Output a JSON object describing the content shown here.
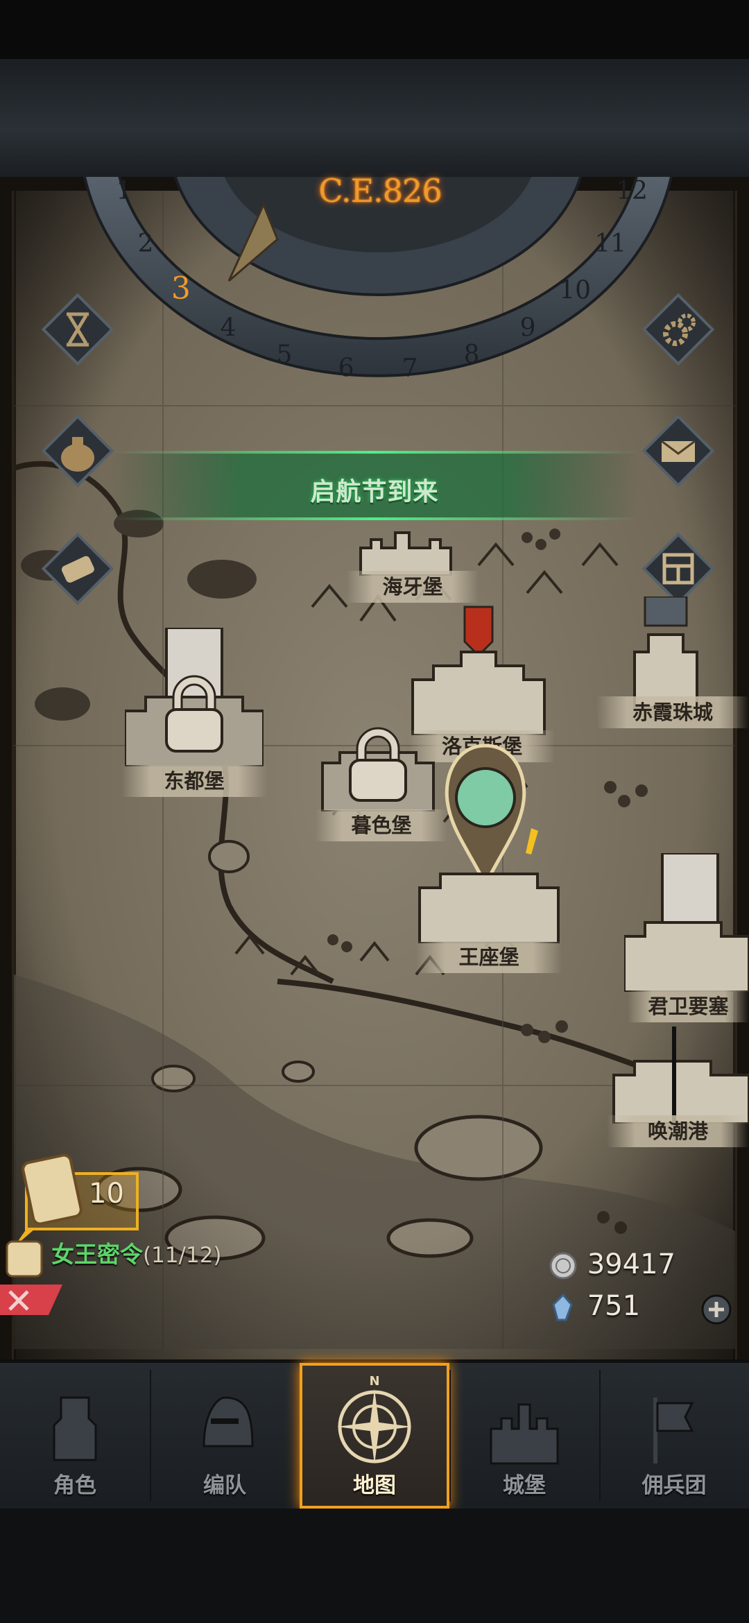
{
  "calendar": {
    "year": "C.E.826",
    "months": [
      "1",
      "2",
      "3",
      "4",
      "5",
      "6",
      "7",
      "8",
      "9",
      "10",
      "11",
      "12"
    ],
    "current_month": "3"
  },
  "event_banner": {
    "text": "启航节到来"
  },
  "castles": {
    "haiya": "海牙堡",
    "chixia": "赤霞珠城",
    "dongdu": "东都堡",
    "luoke": "洛克斯堡",
    "muse": "暮色堡",
    "wangzuo": "王座堡",
    "junwei": "君卫要塞",
    "huanchao": "唤潮港"
  },
  "side_buttons": {
    "left": [
      "hourglass-icon",
      "coin-bag-icon",
      "scroll-icon"
    ],
    "right": [
      "gear-icon",
      "mail-icon",
      "castle-grid-icon"
    ]
  },
  "queen_order": {
    "count": "10",
    "label": "女王密令",
    "progress": "(11/12)"
  },
  "resources": {
    "silver": "39417",
    "crystal": "751"
  },
  "nav": {
    "tabs": [
      "角色",
      "编队",
      "地图",
      "城堡",
      "佣兵团"
    ],
    "active": "地图",
    "compass_north": "N"
  },
  "colors": {
    "accent": "#f0a020",
    "event_green": "#2bd860",
    "order_green": "#5cd66a",
    "enemy_red": "#b8301c"
  }
}
